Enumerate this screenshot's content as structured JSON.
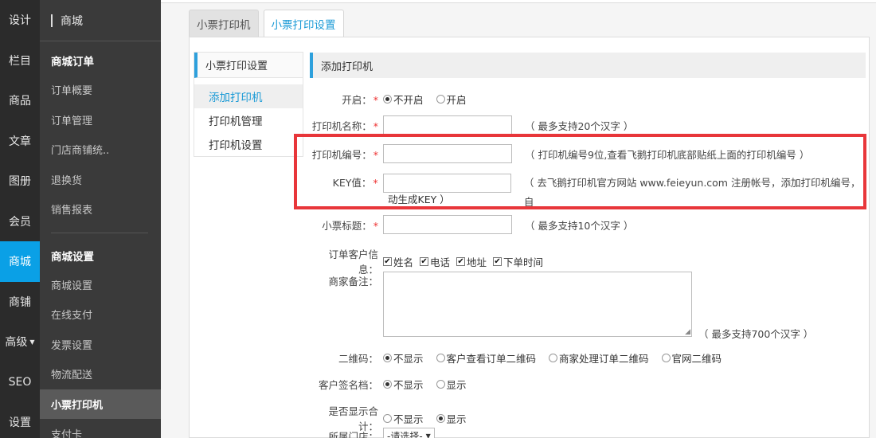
{
  "rail": {
    "items": [
      {
        "label": "设计"
      },
      {
        "label": "栏目"
      },
      {
        "label": "商品"
      },
      {
        "label": "文章"
      },
      {
        "label": "图册"
      },
      {
        "label": "会员"
      },
      {
        "label": "商城"
      },
      {
        "label": "商铺"
      },
      {
        "label": "高级"
      },
      {
        "label": "SEO"
      },
      {
        "label": "设置"
      }
    ],
    "active_index": 6,
    "accent": "#0aa0e6"
  },
  "subnav": {
    "header": "商城",
    "group1": {
      "title": "商城订单",
      "items": [
        "订单概要",
        "订单管理",
        "门店商铺统..",
        "退换货",
        "销售报表"
      ]
    },
    "group2": {
      "title": "商城设置",
      "items": [
        "商城设置",
        "在线支付",
        "发票设置",
        "物流配送",
        "小票打印机",
        "支付卡"
      ]
    }
  },
  "tabs": [
    {
      "label": "小票打印机"
    },
    {
      "label": "小票打印设置"
    }
  ],
  "inner_nav": {
    "header": "小票打印设置",
    "items": [
      "添加打印机",
      "打印机管理",
      "打印机设置"
    ]
  },
  "form": {
    "section_title": "添加打印机",
    "open": {
      "label": "开启：",
      "options": [
        "不开启",
        "开启"
      ]
    },
    "printer_name": {
      "label": "打印机名称：",
      "value": "",
      "hint": "（ 最多支持20个汉字 ）"
    },
    "printer_no": {
      "label": "打印机编号：",
      "value": "",
      "hint": "（ 打印机编号9位,查看飞鹅打印机底部贴纸上面的打印机编号 ）"
    },
    "key": {
      "label": "KEY值：",
      "value": "",
      "hint_line1": "（ 去飞鹅打印机官方网站 www.feieyun.com 注册帐号，添加打印机编号，自",
      "hint_line2": "动生成KEY ）"
    },
    "receipt_title": {
      "label": "小票标题：",
      "value": "",
      "hint": "（ 最多支持10个汉字 ）"
    },
    "customer_info": {
      "label": "订单客户信息：",
      "options": [
        "姓名",
        "电话",
        "地址",
        "下单时间"
      ]
    },
    "merchant_note": {
      "label": "商家备注：",
      "value": "",
      "hint": "（ 最多支持700个汉字 ）"
    },
    "qrcode": {
      "label": "二维码：",
      "options": [
        "不显示",
        "客户查看订单二维码",
        "商家处理订单二维码",
        "官网二维码"
      ]
    },
    "signature": {
      "label": "客户签名档：",
      "options": [
        "不显示",
        "显示"
      ]
    },
    "show_total": {
      "label": "是否显示合计：",
      "options": [
        "不显示",
        "显示"
      ]
    },
    "store": {
      "label": "所属门店：",
      "selected": "-请选择-"
    }
  },
  "colors": {
    "highlight": "#e8363a",
    "tab_active_text": "#1a9ad6"
  }
}
